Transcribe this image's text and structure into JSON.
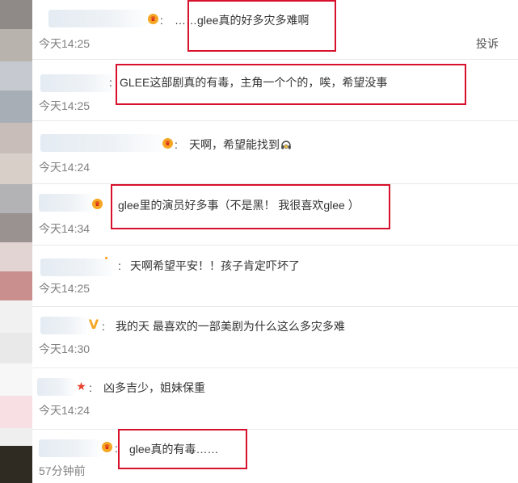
{
  "comments": [
    {
      "separator": ": ",
      "text": "……glee真的好多灾多难啊",
      "time": "今天14:25",
      "report": "投诉",
      "badge": "crown-icon"
    },
    {
      "separator": ": ",
      "text": "GLEE这部剧真的有毒，主角一个个的，唉，希望没事",
      "time": "今天14:25",
      "badge": ""
    },
    {
      "separator": ": ",
      "text": "天啊，希望能找到",
      "time": "今天14:24",
      "badge": "crown-icon",
      "emoji": "headset-emoji-icon"
    },
    {
      "separator": "",
      "text": "glee里的演员好多事（不是黑！ 我很喜欢glee ）",
      "time": "今天14:34",
      "badge": "crown-icon"
    },
    {
      "separator": ": ",
      "text": "天啊希望平安！！孩子肯定吓坏了",
      "time": "今天14:25",
      "badge": ""
    },
    {
      "separator": ": ",
      "text": "我的天 最喜欢的一部美剧为什么这么多灾多难",
      "time": "今天14:30",
      "badge": "vip-v-icon",
      "badge_glyph": "V"
    },
    {
      "separator": ": ",
      "text": "凶多吉少，姐妹保重",
      "time": "今天14:24",
      "badge": "star-icon",
      "badge_glyph": "★"
    },
    {
      "separator": ": ",
      "text": "glee真的有毒……",
      "time": "57分钟前",
      "badge": "crown-icon"
    }
  ],
  "colors": {
    "highlight_box": "#d7102b",
    "timestamp": "#808080",
    "text": "#333333",
    "crown_badge": "#f5a623"
  }
}
